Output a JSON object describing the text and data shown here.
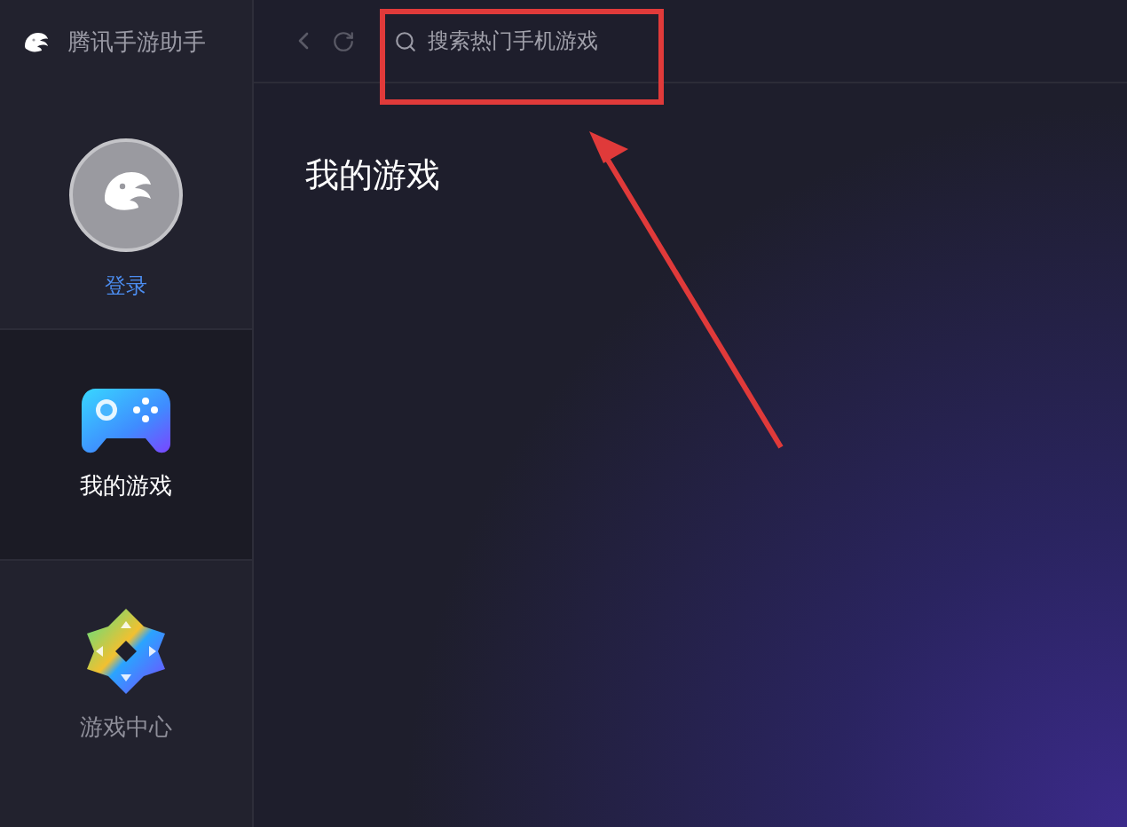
{
  "app": {
    "name": "腾讯手游助手"
  },
  "account": {
    "login": "登录"
  },
  "nav": [
    {
      "kind": "games",
      "label": "我的游戏",
      "selected": true
    },
    {
      "kind": "center",
      "label": "游戏中心",
      "selected": false
    }
  ],
  "search": {
    "placeholder": "搜索热门手机游戏"
  },
  "page": {
    "title": "我的游戏"
  }
}
